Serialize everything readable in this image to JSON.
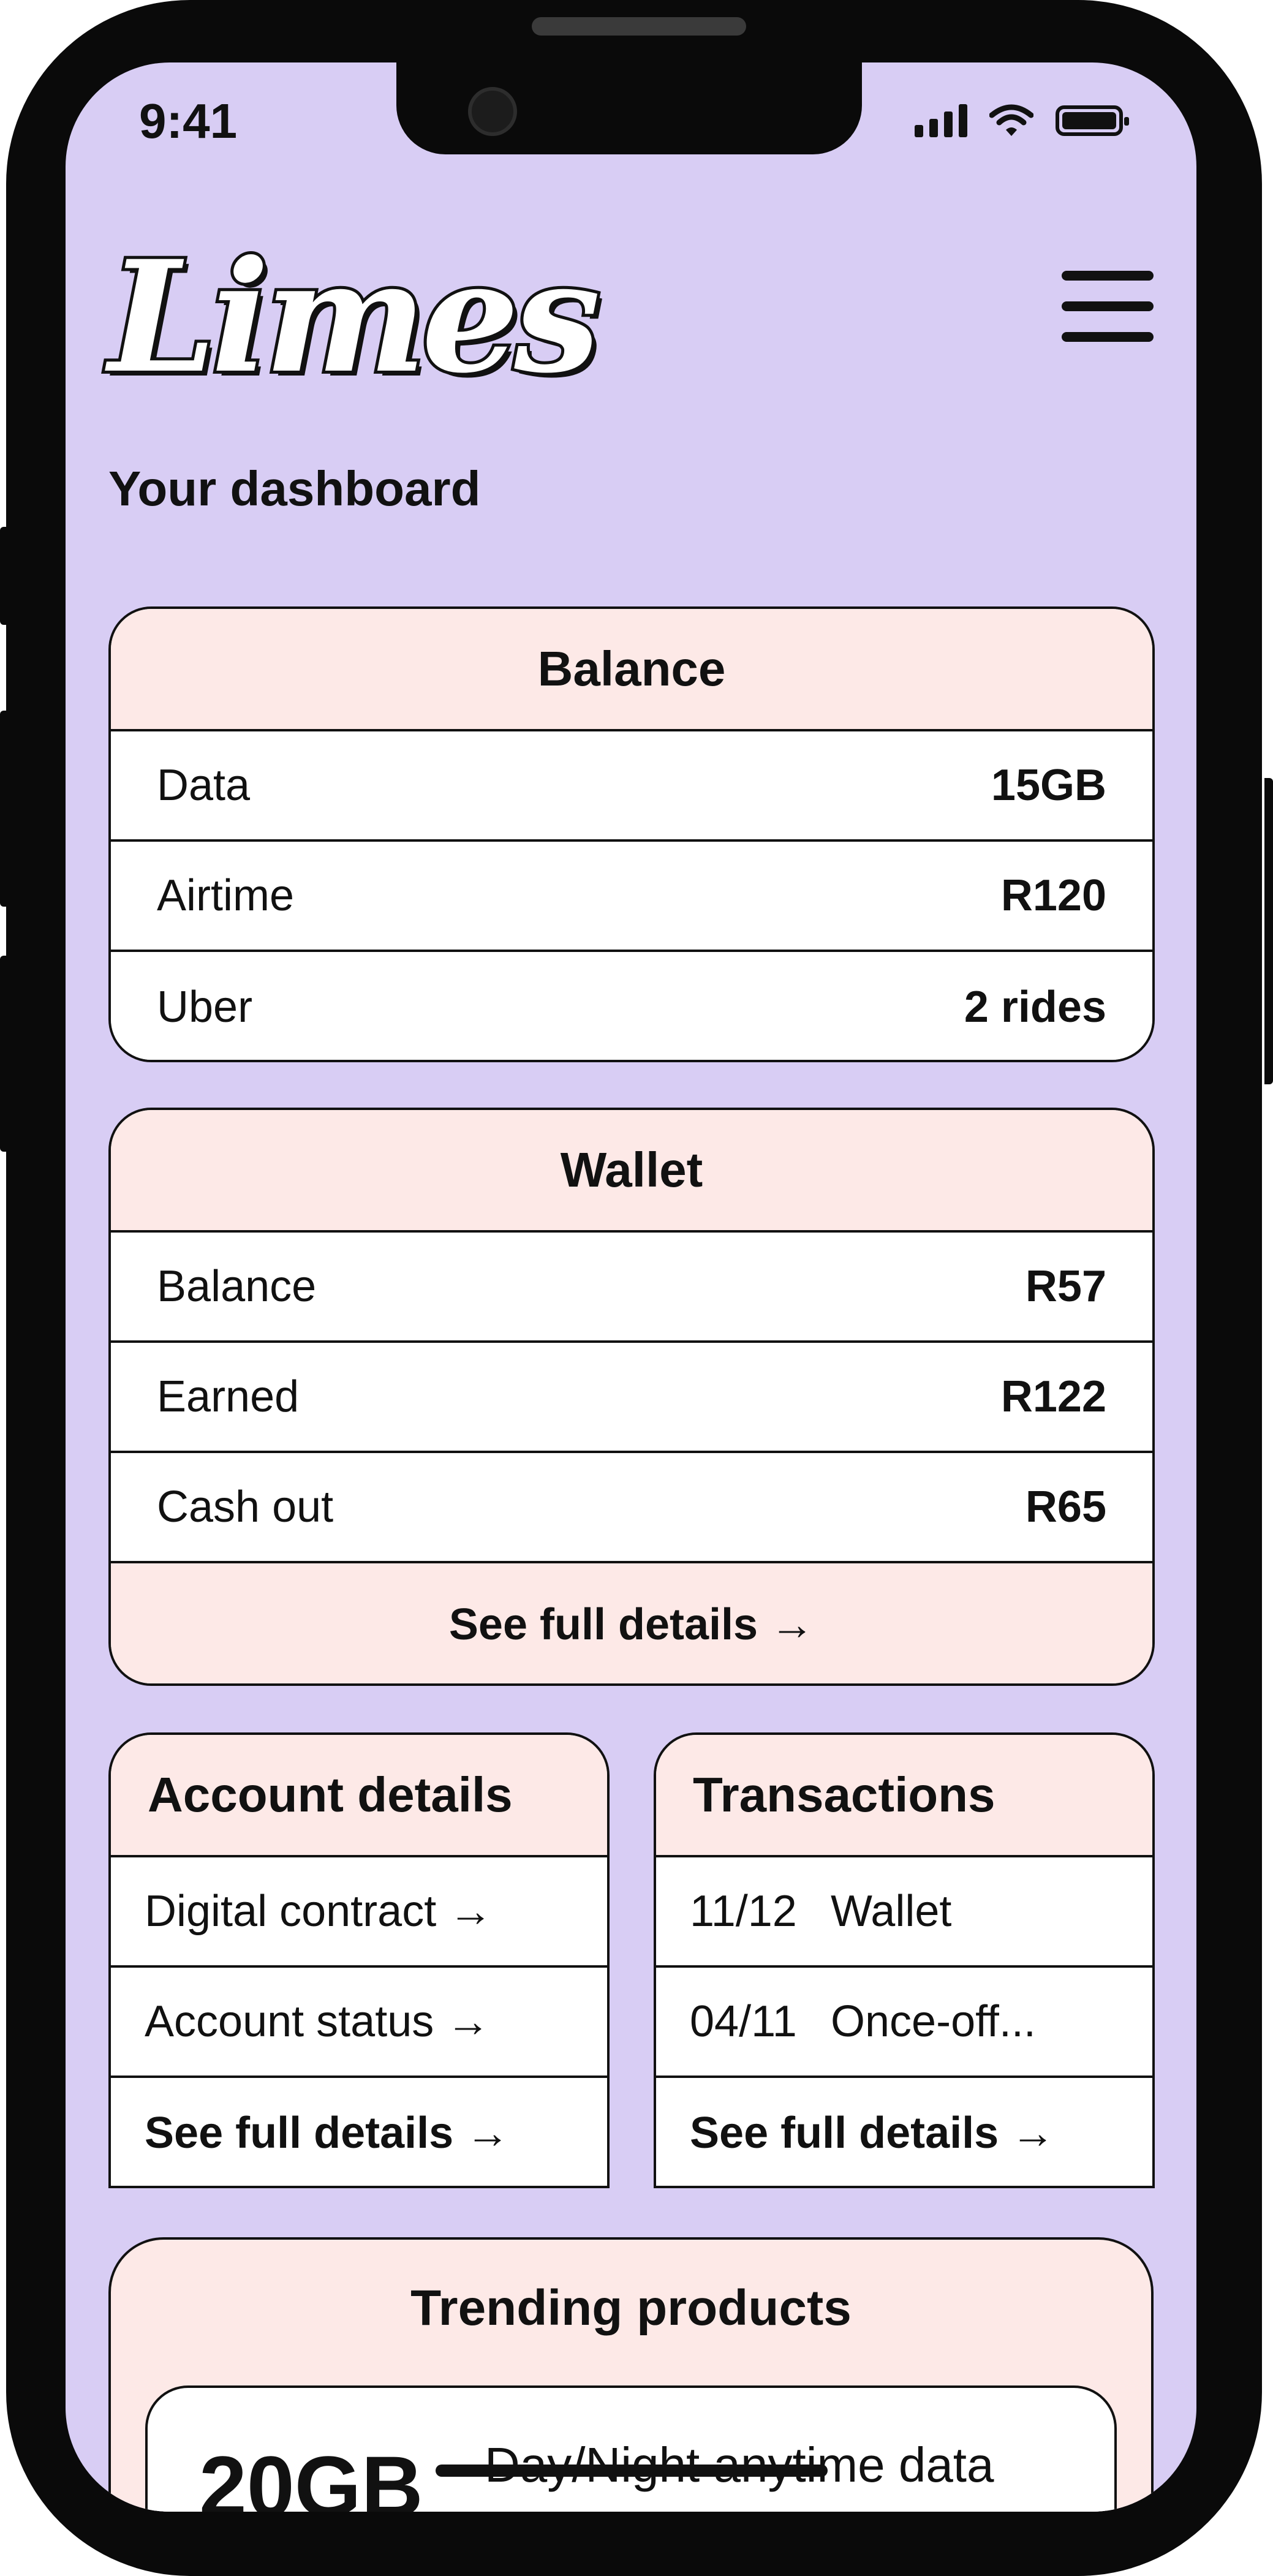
{
  "status_bar": {
    "time": "9:41"
  },
  "header": {
    "logo_text": "Limes"
  },
  "page_title": "Your dashboard",
  "balance_card": {
    "title": "Balance",
    "rows": [
      {
        "label": "Data",
        "value": "15GB"
      },
      {
        "label": "Airtime",
        "value": "R120"
      },
      {
        "label": "Uber",
        "value": "2 rides"
      }
    ]
  },
  "wallet_card": {
    "title": "Wallet",
    "rows": [
      {
        "label": "Balance",
        "value": "R57"
      },
      {
        "label": "Earned",
        "value": "R122"
      },
      {
        "label": "Cash out",
        "value": "R65"
      }
    ],
    "footer_link": "See full details →"
  },
  "account_card": {
    "title": "Account details",
    "items": [
      "Digital contract →",
      "Account status →"
    ],
    "footer_link": "See full details →"
  },
  "transactions_card": {
    "title": "Transactions",
    "items": [
      {
        "date": "11/12",
        "desc": "Wallet"
      },
      {
        "date": "04/11",
        "desc": "Once-off..."
      }
    ],
    "footer_link": "See full details →"
  },
  "trending": {
    "title": "Trending products",
    "product": {
      "size": "20GB",
      "desc": "Day/Night anytime data"
    }
  },
  "colors": {
    "screen_bg": "#d8cdf4",
    "card_header_bg": "#fde9e7",
    "border": "#111111"
  }
}
